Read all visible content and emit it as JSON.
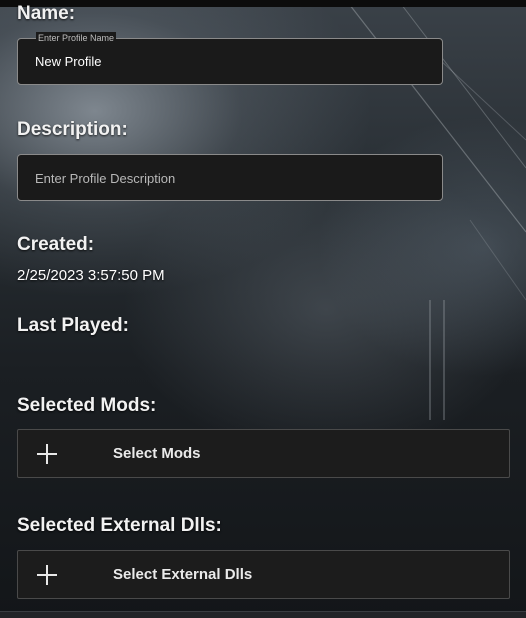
{
  "profile": {
    "name": {
      "label": "Name:",
      "field_legend": "Enter Profile Name",
      "value": "New Profile"
    },
    "description": {
      "label": "Description:",
      "placeholder": "Enter Profile Description",
      "value": ""
    },
    "created": {
      "label": "Created:",
      "value": "2/25/2023 3:57:50 PM"
    },
    "last_played": {
      "label": "Last Played:",
      "value": ""
    },
    "selected_mods": {
      "label": "Selected Mods:",
      "button_label": "Select Mods",
      "button_icon": "plus-icon"
    },
    "selected_dlls": {
      "label": "Selected External Dlls:",
      "button_label": "Select External Dlls",
      "button_icon": "plus-icon"
    }
  },
  "colors": {
    "field_background": "#1a1a1a",
    "field_border": "#8a8a8a",
    "button_background": "#1c1c1c",
    "text": "#ffffff"
  }
}
